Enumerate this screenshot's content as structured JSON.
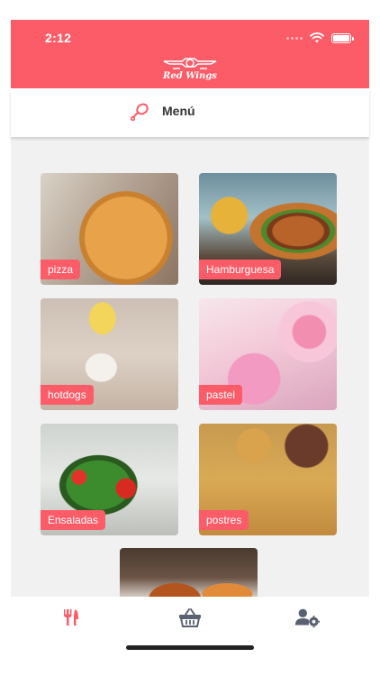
{
  "status_bar": {
    "time": "2:12"
  },
  "header": {
    "logo_text": "Red Wings"
  },
  "menu_bar": {
    "title": "Menú"
  },
  "categories": [
    {
      "label": "pizza"
    },
    {
      "label": "Hamburguesa"
    },
    {
      "label": "hotdogs"
    },
    {
      "label": "pastel"
    },
    {
      "label": "Ensaladas"
    },
    {
      "label": "postres"
    }
  ],
  "tabbar": {
    "items": [
      {
        "icon": "utensils-icon",
        "active": true
      },
      {
        "icon": "basket-icon",
        "active": false
      },
      {
        "icon": "user-settings-icon",
        "active": false
      }
    ]
  },
  "colors": {
    "accent": "#fb5c68",
    "inactive_icon": "#5a6170",
    "background": "#f1f1f1"
  }
}
